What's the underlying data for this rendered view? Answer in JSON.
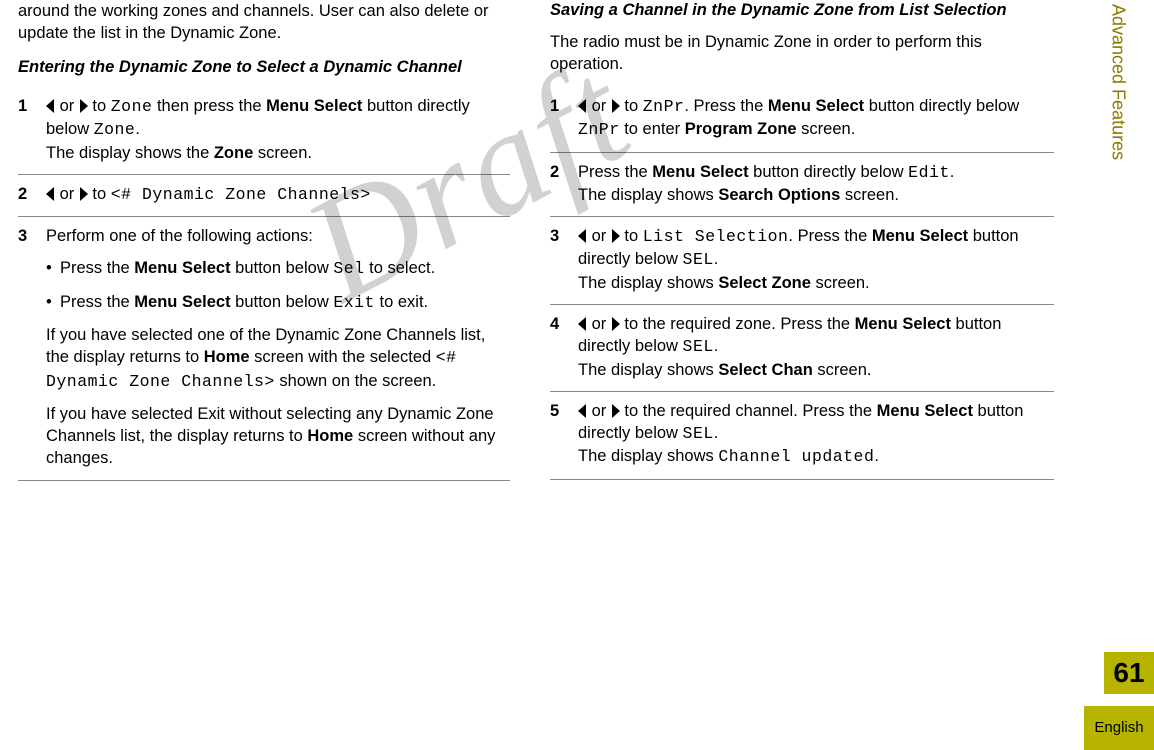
{
  "sidebar": {
    "section_label": "Advanced Features",
    "page_number": "61",
    "language": "English"
  },
  "watermark": "Draft",
  "left": {
    "intro": "around the working zones and channels. User can also delete or update the list in the Dynamic Zone.",
    "subhead": "Entering the Dynamic Zone to Select a Dynamic Channel",
    "step1_a": " or ",
    "step1_b": " to ",
    "step1_zone": "Zone",
    "step1_c": " then press the ",
    "step1_menu": "Menu Select",
    "step1_d": " button directly below ",
    "step1_zone2": "Zone",
    "step1_e": ".",
    "step1_line2a": "The display shows the ",
    "step1_line2b": "Zone",
    "step1_line2c": " screen.",
    "step2_a": " or ",
    "step2_b": " to ",
    "step2_code": "<# Dynamic Zone Channels>",
    "step3_intro": "Perform one of the following actions:",
    "step3_b1a": "Press the ",
    "step3_b1b": "Menu Select",
    "step3_b1c": " button below ",
    "step3_b1d": "Sel",
    "step3_b1e": " to select.",
    "step3_b2a": "Press the ",
    "step3_b2b": "Menu Select",
    "step3_b2c": " button below ",
    "step3_b2d": "Exit",
    "step3_b2e": " to exit.",
    "step3_p1a": "If you have selected one of the Dynamic Zone Channels list, the display returns to ",
    "step3_p1b": "Home",
    "step3_p1c": " screen with the selected ",
    "step3_p1d": "<# Dynamic Zone Channels>",
    "step3_p1e": " shown on the screen.",
    "step3_p2a": "If you have selected Exit without selecting any Dynamic Zone Channels list, the display returns to ",
    "step3_p2b": "Home",
    "step3_p2c": " screen without any changes."
  },
  "right": {
    "subhead": "Saving a Channel in the Dynamic Zone from List Selection",
    "intro": "The radio must be in Dynamic Zone in order to perform this operation.",
    "s1_a": " or ",
    "s1_b": " to ",
    "s1_znpr": "ZnPr",
    "s1_c": ". Press the ",
    "s1_menu": "Menu Select",
    "s1_d": " button directly below ",
    "s1_znpr2": "ZnPr",
    "s1_e": " to enter ",
    "s1_pz": "Program Zone",
    "s1_f": " screen.",
    "s2_a": "Press the ",
    "s2_b": "Menu Select",
    "s2_c": " button directly below ",
    "s2_d": "Edit",
    "s2_e": ".",
    "s2_l2a": "The display shows ",
    "s2_l2b": "Search Options",
    "s2_l2c": " screen.",
    "s3_a": " or ",
    "s3_b": " to ",
    "s3_ls": "List Selection",
    "s3_c": ". Press the ",
    "s3_menu": "Menu Select",
    "s3_d": " button directly below ",
    "s3_sel": "SEL",
    "s3_e": ".",
    "s3_l2a": "The display shows ",
    "s3_l2b": "Select Zone",
    "s3_l2c": " screen.",
    "s4_a": " or ",
    "s4_b": " to the required zone. Press the ",
    "s4_menu": "Menu Select",
    "s4_c": " button directly below ",
    "s4_sel": "SEL",
    "s4_d": ".",
    "s4_l2a": "The display shows ",
    "s4_l2b": "Select Chan",
    "s4_l2c": " screen.",
    "s5_a": " or ",
    "s5_b": " to the required channel. Press the ",
    "s5_menu": "Menu Select",
    "s5_c": " button directly below ",
    "s5_sel": "SEL",
    "s5_d": ".",
    "s5_l2a": "The display shows ",
    "s5_l2b": "Channel updated",
    "s5_l2c": "."
  }
}
